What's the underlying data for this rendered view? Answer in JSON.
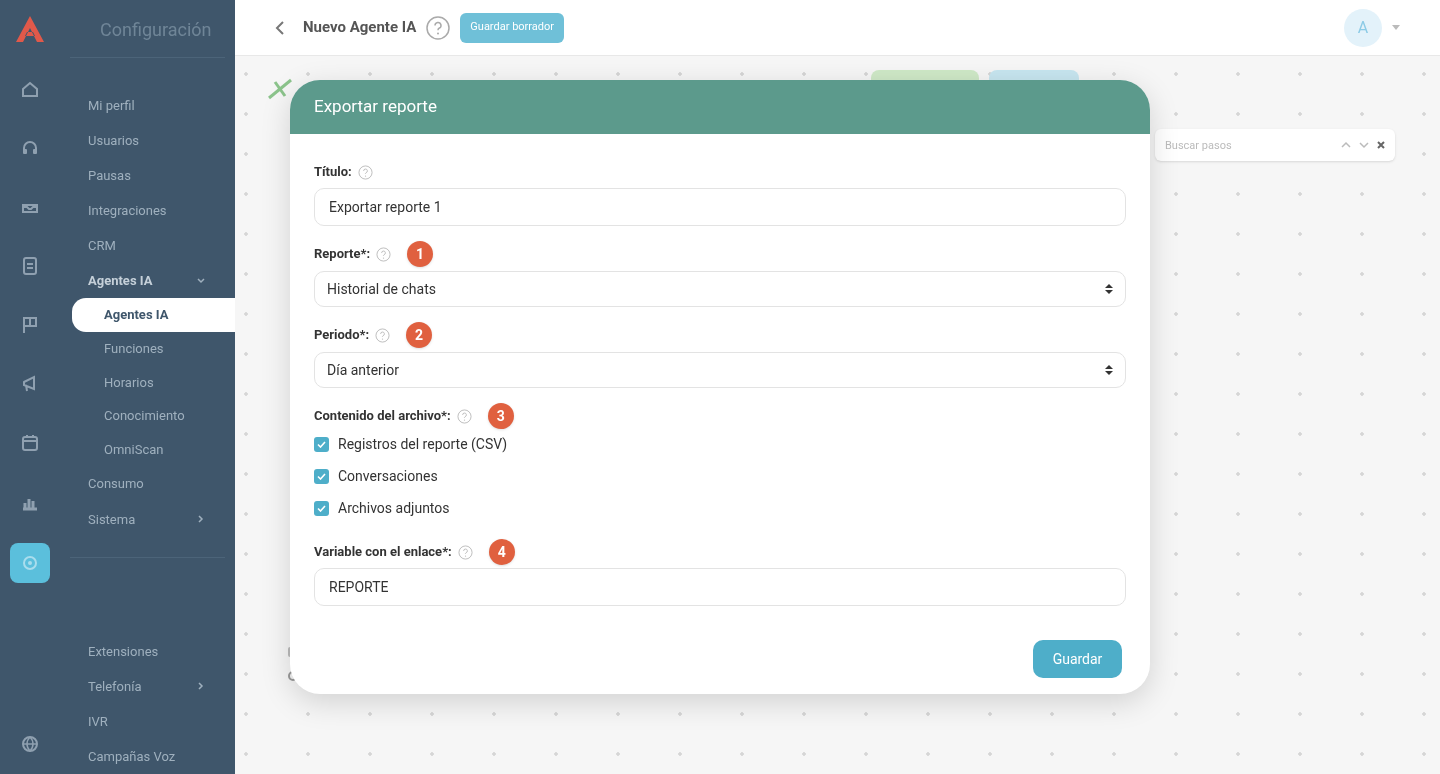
{
  "sidebar": {
    "title": "Configuración",
    "rail": [
      {
        "selected": false
      },
      {
        "selected": false
      },
      {
        "selected": false
      },
      {
        "selected": false
      },
      {
        "selected": false
      },
      {
        "selected": false
      },
      {
        "selected": false
      },
      {
        "selected": false
      },
      {
        "selected": true
      },
      {
        "selected": false
      }
    ],
    "items": [
      {
        "label": "Mi perfil",
        "selected": false
      },
      {
        "label": "Usuarios",
        "selected": false
      },
      {
        "label": "Pausas",
        "selected": false
      },
      {
        "label": "Integraciones",
        "selected": false
      },
      {
        "label": "CRM",
        "selected": false
      },
      {
        "label": "Agentes IA",
        "selected": false,
        "expanded": true,
        "children": [
          {
            "label": "Agentes IA",
            "selected": true
          },
          {
            "label": "Funciones",
            "selected": false
          },
          {
            "label": "Horarios",
            "selected": false
          },
          {
            "label": "Conocimiento",
            "selected": false
          },
          {
            "label": "OmniScan",
            "selected": false
          }
        ]
      },
      {
        "label": "Consumo",
        "selected": false
      },
      {
        "label": "Sistema",
        "selected": false,
        "expanded": false
      },
      {
        "kind": "divider"
      },
      {
        "label": "Extensiones",
        "selected": false
      },
      {
        "label": "Telefonía",
        "selected": false,
        "expanded": false
      },
      {
        "label": "IVR",
        "selected": false
      },
      {
        "label": "Campañas Voz",
        "selected": false
      }
    ]
  },
  "header": {
    "title": "Nuevo Agente IA",
    "draft_button": "Guardar borrador",
    "avatar": "A"
  },
  "search": {
    "placeholder": "Buscar pasos"
  },
  "dialog": {
    "title": "Exportar reporte",
    "fields": [
      {
        "kind": "input",
        "label": "Título:",
        "value": "Exportar reporte 1"
      },
      {
        "kind": "select",
        "label": "Reporte*:",
        "badge": "1",
        "value": "Historial de chats"
      },
      {
        "kind": "select",
        "label": "Periodo*:",
        "badge": "2",
        "value": "Día anterior"
      },
      {
        "kind": "checks",
        "label": "Contenido del archivo*:",
        "badge": "3",
        "options": [
          {
            "label": "Registros del reporte (CSV)",
            "checked": true
          },
          {
            "label": "Conversaciones",
            "checked": true
          },
          {
            "label": "Archivos adjuntos",
            "checked": true
          }
        ]
      },
      {
        "kind": "input",
        "label": "Variable con el enlace*:",
        "badge": "4",
        "value": "REPORTE"
      }
    ],
    "save_button": "Guardar"
  }
}
